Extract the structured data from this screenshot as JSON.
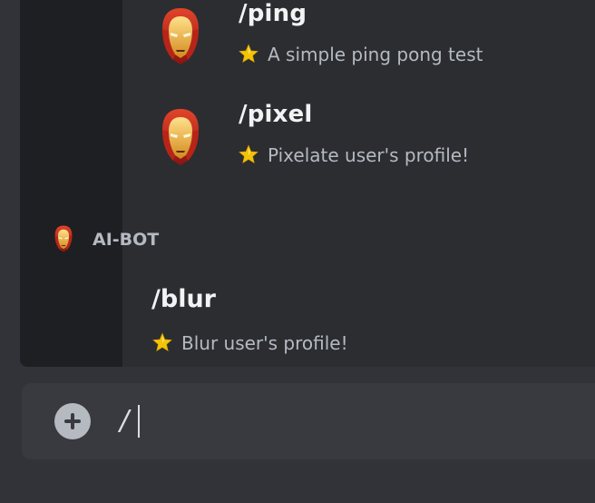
{
  "commands": [
    {
      "name": "/ping",
      "description": "A simple ping pong test"
    },
    {
      "name": "/pixel",
      "description": "Pixelate user's profile!"
    }
  ],
  "bot": {
    "name": "AI-BOT"
  },
  "bot_command": {
    "name": "/blur",
    "description": "Blur user's profile!"
  },
  "input": {
    "value": "/"
  },
  "icons": {
    "avatar": "ironman-mask-icon",
    "star": "star-icon",
    "add": "plus-circle-icon"
  },
  "colors": {
    "background": "#313338",
    "popup": "#2b2d31",
    "popup_sidebar": "#1e1f22",
    "command_name": "#f2f3f5",
    "command_desc": "#b5bac1",
    "input_bg": "#383a40",
    "star": "#f5c400"
  }
}
